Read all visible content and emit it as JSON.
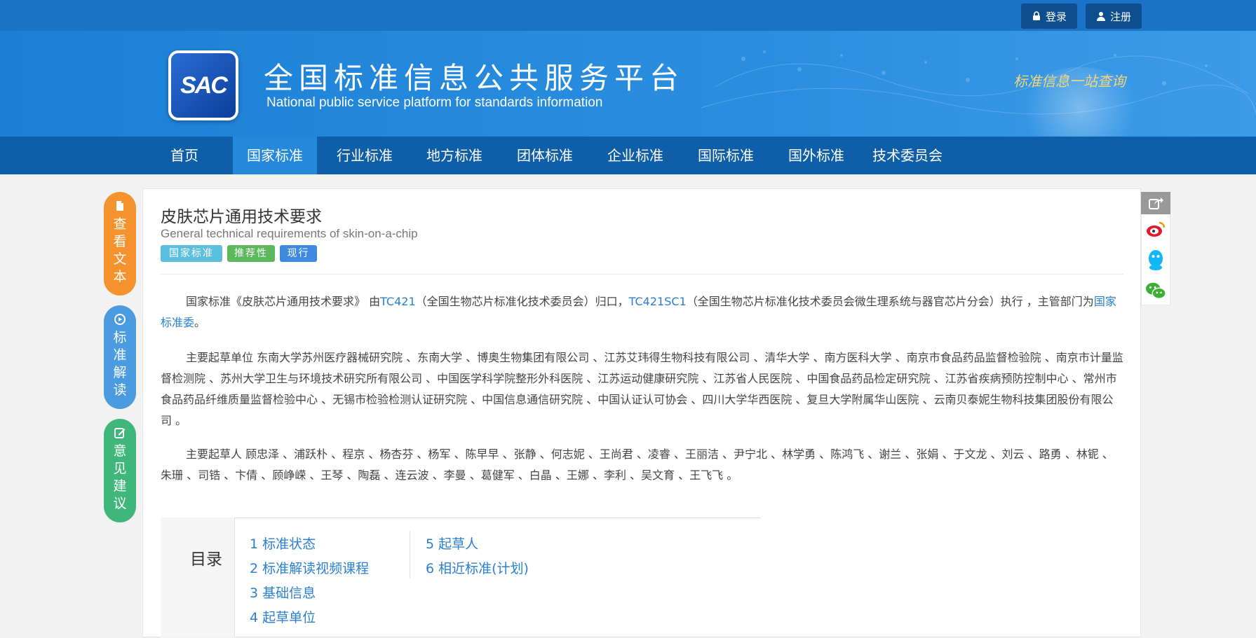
{
  "topbar": {
    "login_label": "登录",
    "register_label": "注册"
  },
  "banner": {
    "logo_text": "SAC",
    "title": "全国标准信息公共服务平台",
    "subtitle": "National public service platform  for standards information",
    "slogan": "标准信息一站查询"
  },
  "nav": {
    "items": [
      "首页",
      "国家标准",
      "行业标准",
      "地方标准",
      "团体标准",
      "企业标准",
      "国际标准",
      "国外标准",
      "技术委员会"
    ],
    "active": "国家标准"
  },
  "side_buttons": [
    {
      "label": "查看文本",
      "color": "#f5922e",
      "icon": "document-icon"
    },
    {
      "label": "标准解读",
      "color": "#4a9be0",
      "icon": "play-icon"
    },
    {
      "label": "意见建议",
      "color": "#3fb77a",
      "icon": "edit-icon"
    }
  ],
  "standard": {
    "title": "皮肤芯片通用技术要求",
    "english_title": "General technical requirements of skin-on-a-chip",
    "tags": [
      {
        "label": "国家标准",
        "color": "#5bc0de"
      },
      {
        "label": "推荐性",
        "color": "#5cb85c"
      },
      {
        "label": "现行",
        "color": "#3f8ae0"
      }
    ]
  },
  "description": {
    "p1_lead": "国家标准《皮肤芯片通用技术要求》 由",
    "tc1": "TC421",
    "p1_mid1": "（全国生物芯片标准化技术委员会）归口，",
    "tc2": "TC421SC1",
    "p1_mid2": "（全国生物芯片标准化技术委员会微生理系统与器官芯片分会）执行 ，主管部门为",
    "authority": "国家标准委",
    "p1_end": "。",
    "p2": "主要起草单位 东南大学苏州医疗器械研究院 、东南大学 、博奥生物集团有限公司 、江苏艾玮得生物科技有限公司 、清华大学 、南方医科大学 、南京市食品药品监督检验院 、南京市计量监督检测院 、苏州大学卫生与环境技术研究所有限公司 、中国医学科学院整形外科医院 、江苏运动健康研究院 、江苏省人民医院 、中国食品药品检定研究院 、江苏省疾病预防控制中心 、常州市食品药品纤维质量监督检验中心 、无锡市检验检测认证研究院 、中国信息通信研究院 、中国认证认可协会 、四川大学华西医院 、复旦大学附属华山医院 、云南贝泰妮生物科技集团股份有限公司 。",
    "p3": "主要起草人 顾忠泽 、浦跃朴 、程京 、杨杏芬 、杨军 、陈早早 、张静 、何志妮 、王尚君 、凌睿 、王丽洁 、尹宁北 、林学勇 、陈鸿飞 、谢兰 、张娟 、于文龙 、刘云 、路勇 、林铌 、朱珊 、司锆 、卞倩 、顾峥嵘 、王琴 、陶磊 、连云波 、李曼 、葛健军 、白晶 、王娜 、李利 、吴文育 、王飞飞 。"
  },
  "toc": {
    "label": "目录",
    "items": [
      "1  标准状态",
      "2  标准解读视频课程",
      "3  基础信息",
      "4  起草单位",
      "5  起草人",
      "6  相近标准(计划)"
    ]
  },
  "share": {
    "icons": [
      "share-icon",
      "weibo-icon",
      "qq-icon",
      "wechat-icon"
    ]
  }
}
